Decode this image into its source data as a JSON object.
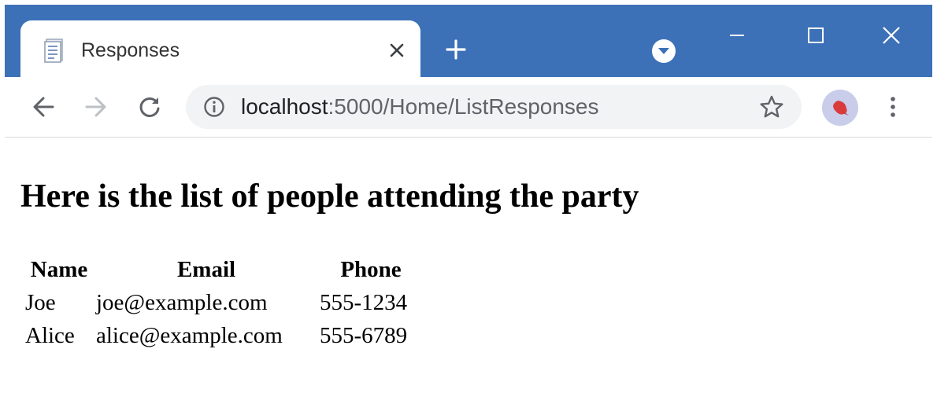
{
  "browser": {
    "tab": {
      "title": "Responses",
      "close_label": "close tab"
    },
    "address": {
      "host": "localhost",
      "path": ":5000/Home/ListResponses"
    }
  },
  "page": {
    "heading": "Here is the list of people attending the party",
    "table": {
      "headers": [
        "Name",
        "Email",
        "Phone"
      ],
      "rows": [
        [
          "Joe",
          "joe@example.com",
          "555-1234"
        ],
        [
          "Alice",
          "alice@example.com",
          "555-6789"
        ]
      ]
    }
  },
  "colors": {
    "titlebar": "#3c71b7",
    "omnibox": "#f1f3f4"
  },
  "icons": [
    "document-icon",
    "close-icon",
    "plus-icon",
    "chevron-down-icon",
    "minimize-icon",
    "maximize-icon",
    "window-close-icon",
    "back-arrow-icon",
    "forward-arrow-icon",
    "reload-icon",
    "info-icon",
    "star-icon",
    "avatar-icon",
    "more-vert-icon"
  ]
}
